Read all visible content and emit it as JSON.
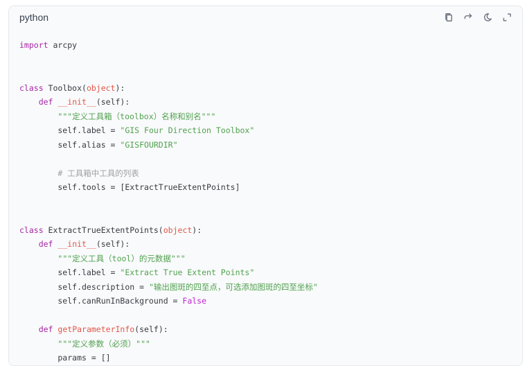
{
  "header": {
    "language": "python",
    "icons": [
      "copy-icon",
      "wrap-icon",
      "theme-icon",
      "expand-icon"
    ]
  },
  "colors": {
    "keyword": "#a626a4",
    "function": "#e45649",
    "string": "#50a14f",
    "comment": "#a0a1a7",
    "plain": "#383a42"
  },
  "code": {
    "l1": {
      "a": "import",
      "b": " arcpy"
    },
    "l4": {
      "a": "class",
      "b": " Toolbox(",
      "c": "object",
      "d": "):"
    },
    "l5": {
      "a": "    ",
      "b": "def",
      "c": " ",
      "d": "__init__",
      "e": "(self):"
    },
    "l6": {
      "a": "        ",
      "b": "\"\"\"定义工具箱（toolbox）名称和别名\"\"\""
    },
    "l7": {
      "a": "        self.label = ",
      "b": "\"GIS Four Direction Toolbox\""
    },
    "l8": {
      "a": "        self.alias = ",
      "b": "\"GISFOURDIR\""
    },
    "l10": {
      "a": "        ",
      "b": "# 工具箱中工具的列表"
    },
    "l11": {
      "a": "        self.tools = [ExtractTrueExtentPoints]"
    },
    "l14": {
      "a": "class",
      "b": " ExtractTrueExtentPoints(",
      "c": "object",
      "d": "):"
    },
    "l15": {
      "a": "    ",
      "b": "def",
      "c": " ",
      "d": "__init__",
      "e": "(self):"
    },
    "l16": {
      "a": "        ",
      "b": "\"\"\"定义工具（tool）的元数据\"\"\""
    },
    "l17": {
      "a": "        self.label = ",
      "b": "\"Extract True Extent Points\""
    },
    "l18": {
      "a": "        self.description = ",
      "b": "\"输出图斑的四至点，可选添加图斑的四至坐标\""
    },
    "l19": {
      "a": "        self.canRunInBackground = ",
      "b": "False"
    },
    "l21": {
      "a": "    ",
      "b": "def",
      "c": " ",
      "d": "getParameterInfo",
      "e": "(self):"
    },
    "l22": {
      "a": "        ",
      "b": "\"\"\"定义参数（必须）\"\"\""
    },
    "l23": {
      "a": "        params = []"
    }
  }
}
